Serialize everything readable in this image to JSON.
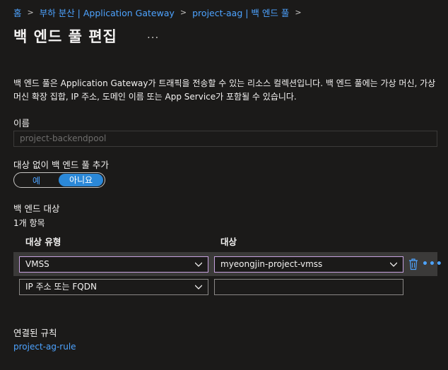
{
  "breadcrumb": {
    "items": [
      "홈",
      "부하 분산 | Application Gateway",
      "project-aag | 백 엔드 풀"
    ],
    "separator": ">"
  },
  "page": {
    "title": "백 엔드 풀 편집",
    "more": "...",
    "description": "백 엔드 풀은 Application Gateway가 트래픽을 전송할 수 있는 리소스 컬렉션입니다. 백 엔드 풀에는 가상 머신, 가상 머신 확장 집합, IP 주소, 도메인 이름 또는 App Service가 포함될 수 있습니다."
  },
  "name_field": {
    "label": "이름",
    "value": "project-backendpool"
  },
  "no_target": {
    "label": "대상 없이 백 엔드 풀 추가",
    "options": [
      "예",
      "아니요"
    ],
    "selected": "아니요"
  },
  "targets": {
    "section_label": "백 엔드 대상",
    "count_label": "1개 항목",
    "col_type": "대상 유형",
    "col_target": "대상",
    "rows": [
      {
        "type": "VMSS",
        "target": "myeongjin-project-vmss"
      },
      {
        "type": "IP 주소 또는 FQDN",
        "target": ""
      }
    ]
  },
  "rules": {
    "label": "연결된 규칙",
    "link": "project-ag-rule"
  },
  "colors": {
    "background": "#1b1a19",
    "link": "#4da3ff",
    "toggle_on": "#2b88d8",
    "focus_border": "#c8a2e0"
  }
}
